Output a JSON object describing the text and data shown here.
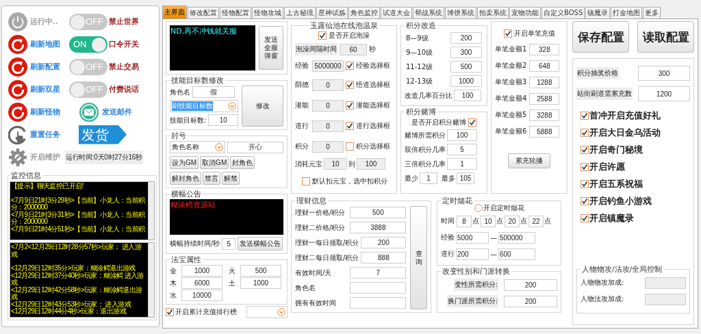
{
  "left_panel": {
    "actions": [
      {
        "kind": "power",
        "label": "运行中..",
        "disabled": true
      },
      {
        "kind": "refresh",
        "label": "刷新地图",
        "disabled": false
      },
      {
        "kind": "refresh",
        "label": "刷新配置",
        "disabled": false
      },
      {
        "kind": "refresh",
        "label": "刷新双星",
        "disabled": false
      },
      {
        "kind": "refresh",
        "label": "刷新怪物",
        "disabled": false
      },
      {
        "kind": "touch",
        "label": "重置任务",
        "disabled": false
      },
      {
        "kind": "gear",
        "label": "开启维护",
        "disabled": true
      }
    ],
    "toggles": [
      {
        "text": "OFF",
        "on": false,
        "label": "禁止世界"
      },
      {
        "text": "ON",
        "on": true,
        "label": "口令开关"
      },
      {
        "text": "OFF",
        "on": false,
        "label": "禁止交易"
      },
      {
        "text": "OFF",
        "on": false,
        "label": "付费说话"
      }
    ],
    "mail_button": "发送邮件",
    "ship_tag": "发货",
    "uptime": "运行时间:0天0时27分16秒",
    "monitor": {
      "title": "监控信息",
      "chat_log": [
        "【提示】聊天监控已开启!",
        "<7月9日21时3分29秒>【当前】小龙人：当前积分：2000000",
        "<7月9日21时3分31秒>【当前】小龙人：当前积分：2000000",
        "<7月9日21时4分51秒>【当前】小龙人：当前积"
      ],
      "login_log": [
        "<7月2<12月29日12时28分57秒>玩家： 进入游戏",
        "<12月29日12时35分>玩家：糊涂鳄退出游戏",
        "<12月29日12时37分40秒>玩家：糊涂鳄 进入游戏",
        "<12月29日12时42分58秒>玩家：糊涂鳄退出游戏",
        "<12月29日12时43分53秒>玩家：  进入游戏",
        "<12月29日12时44分4秒>玩家：退出游戏"
      ]
    }
  },
  "tabs": [
    {
      "label": "主界面",
      "selected": true
    },
    {
      "label": "修改配置",
      "selected": false
    },
    {
      "label": "怪物配置",
      "selected": false
    },
    {
      "label": "怪物攻城",
      "selected": false
    },
    {
      "label": "上古秘境",
      "selected": false
    },
    {
      "label": "星神试炼",
      "selected": false
    },
    {
      "label": "角色监控",
      "selected": false
    },
    {
      "label": "试道大会",
      "selected": false
    },
    {
      "label": "帮战系统",
      "selected": false
    },
    {
      "label": "博饼系统",
      "selected": false
    },
    {
      "label": "拍卖系统",
      "selected": false
    },
    {
      "label": "宠物功能",
      "selected": false
    },
    {
      "label": "自定义BOSS",
      "selected": false
    },
    {
      "label": "镇魔录",
      "selected": false
    },
    {
      "label": "打金地图",
      "selected": false
    },
    {
      "label": "更多",
      "selected": false
    }
  ],
  "broadcast": {
    "message": "ND,再不冲钱就关服",
    "button": "发送全服弹窗"
  },
  "skill_target": {
    "title": "技能目标数修改",
    "name_label": "角色名",
    "name_value": "假",
    "dropdown": "刷技能目标数",
    "count_label": "技能目标数:",
    "count_value": "10",
    "button": "修改"
  },
  "ban": {
    "title": "封号",
    "dropdown": "角色名称",
    "name_value": "开心",
    "buttons": [
      "设为GM",
      "取消GM",
      "封角色",
      "解封角色",
      "禁言",
      "解禁"
    ]
  },
  "banner": {
    "title": "横幅公告",
    "message": "糊涂鳄资源站",
    "duration_label": "横幅持续时间/秒",
    "duration_value": "5",
    "button": "发送横幅公告"
  },
  "treasure": {
    "title": "法宝属性",
    "left": [
      {
        "label": "金",
        "value": "1000"
      },
      {
        "label": "木",
        "value": "6000"
      },
      {
        "label": "水",
        "value": "10000"
      }
    ],
    "right": [
      {
        "label": "火",
        "value": "500"
      },
      {
        "label": "土",
        "value": "1000"
      }
    ]
  },
  "ranking": {
    "label": "开启累计充值排行榜",
    "checked": true
  },
  "hot_spring": {
    "title": "玉露仙池在线泡温泉",
    "enable": {
      "label": "是否开启泡澡",
      "checked": true
    },
    "interval": {
      "label": "泡澡间隔时间",
      "value": "60",
      "unit": "秒"
    },
    "rows": [
      {
        "label": "经验",
        "value": "5000000",
        "check_label": "经验选择框",
        "checked": true
      },
      {
        "label": "阴德",
        "value": "0",
        "check_label": "悟道选择框",
        "checked": true
      },
      {
        "label": "潜能",
        "value": "0",
        "check_label": "潜能选择框",
        "checked": true
      },
      {
        "label": "道行",
        "value": "0",
        "check_label": "道行选择框",
        "checked": true
      },
      {
        "label": "积分",
        "value": "0",
        "check_label": "积分选择框",
        "checked": false
      }
    ],
    "cost": {
      "label": "消耗元宝",
      "from": "10",
      "to_label": "到",
      "to": "100"
    },
    "deduct": {
      "label": "默认扣元宝，选中扣积分",
      "checked": false
    }
  },
  "upgrade": {
    "title": "积分改造",
    "rows": [
      {
        "label": "8—9级",
        "value": "200"
      },
      {
        "label": "9—10级",
        "value": "300"
      },
      {
        "label": "11-12级",
        "value": "500"
      },
      {
        "label": "12-13级",
        "value": "1000"
      }
    ],
    "rate": {
      "label": "改造几率百分比",
      "value": "100"
    }
  },
  "gamble": {
    "title": "积分赌博",
    "enable": {
      "label": "是否开启积分赌博",
      "checked": true
    },
    "rows": [
      {
        "label": "赌博所需积分",
        "value": "100"
      },
      {
        "label": "双倍积分几率",
        "value": "5"
      },
      {
        "label": "三倍积分几率",
        "value": "1"
      }
    ],
    "min": {
      "label": "最少",
      "value": "1"
    },
    "max": {
      "label": "最多",
      "value": "105"
    }
  },
  "single_recharge": {
    "enable": {
      "label": "开启单笔充值",
      "checked": true
    },
    "rows": [
      {
        "label": "单笔金额1",
        "value": "328"
      },
      {
        "label": "单笔金额2",
        "value": "648"
      },
      {
        "label": "单笔金额3",
        "value": "1288"
      },
      {
        "label": "单笔金额4",
        "value": "2588"
      },
      {
        "label": "单笔金额5",
        "value": "3288"
      },
      {
        "label": "单笔金额6",
        "value": "5888"
      }
    ],
    "button": "累充轮播"
  },
  "finance": {
    "title": "理财信息",
    "rows": [
      {
        "label": "理财一价格/积分",
        "value": "500"
      },
      {
        "label": "理财二价格/积分",
        "value": "3888"
      },
      {
        "label": "理财一每日领取/积分",
        "value": "200"
      },
      {
        "label": "理财二每日领取/积分",
        "value": "888"
      },
      {
        "label": "有效时间/天",
        "value": "7"
      },
      {
        "label": "角色名",
        "value": ""
      },
      {
        "label": "拥有有效时间",
        "value": ""
      }
    ],
    "button": "查询"
  },
  "fireworks": {
    "title": "定时烟花",
    "enable": {
      "label": "开启定时烟花",
      "checked": false
    },
    "time_label": "时间",
    "times": [
      {
        "value": "8",
        "unit": "点"
      },
      {
        "value": "10",
        "unit": "点"
      },
      {
        "value": "20",
        "unit": "点"
      },
      {
        "value": "22",
        "unit": "点"
      }
    ],
    "ranges": [
      {
        "label": "经验",
        "from": "5000",
        "dash": "—",
        "to": "500000"
      },
      {
        "label": "道行",
        "from": "200",
        "dash": "—",
        "to": "600"
      }
    ]
  },
  "gender_switch": {
    "title": "改变性别和门派转换",
    "rows": [
      {
        "label": "变性所需积分:",
        "value": "200"
      },
      {
        "label": "换门派所需积分:",
        "value": "200"
      }
    ]
  },
  "save_button": "保存配置",
  "load_button": "读取配置",
  "settings": {
    "rows": [
      {
        "label": "积分抽奖价格",
        "value": "300"
      },
      {
        "label": "站街刷道需累充数",
        "value": "1200"
      }
    ],
    "options": [
      {
        "label": "首冲开启充值好礼",
        "checked": true
      },
      {
        "label": "开启大日金乌活动",
        "checked": true
      },
      {
        "label": "开启奇门秘境",
        "checked": true
      },
      {
        "label": "开启许愿",
        "checked": true
      },
      {
        "label": "开启五系祝福",
        "checked": true
      },
      {
        "label": "开启钓鱼小游戏",
        "checked": true
      },
      {
        "label": "开启镇魔录",
        "checked": true
      }
    ],
    "control": {
      "title": "人物物攻/法攻/全局控制",
      "rows": [
        {
          "label": "人物物攻加成:"
        },
        {
          "label": "人物法攻加成:"
        }
      ]
    }
  }
}
